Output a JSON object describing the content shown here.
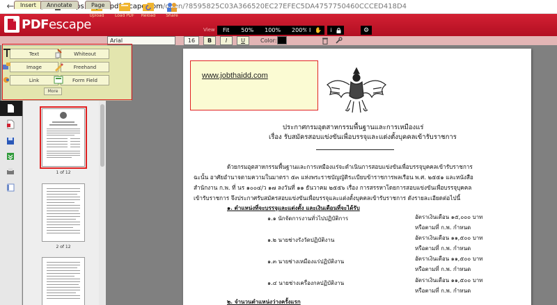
{
  "browser": {
    "url_host": "https://www.pdfescape.com",
    "url_path": "/open/?8595825C03A366520EC27EFEC5DA4757750460CCCED418D4"
  },
  "app": {
    "brand_pdf": "PDF",
    "brand_escape": "escape",
    "toolbar_groups": [
      {
        "label": "Upload"
      },
      {
        "label": "Load PDF"
      },
      {
        "label": "Reload"
      },
      {
        "label": "Share"
      }
    ],
    "view_label": "View",
    "zoom_options": [
      "Fit",
      "50%",
      "100%",
      "200%"
    ],
    "colors": {
      "header": "#c8102e",
      "menu_bg": "#ecefb2",
      "selection": "#e02020"
    }
  },
  "tabs": [
    {
      "label": "Insert",
      "active": true
    },
    {
      "label": "Annotate",
      "active": false
    },
    {
      "label": "Page",
      "active": false
    }
  ],
  "format": {
    "font": "Arial",
    "size": "16",
    "bold": "B",
    "italic": "I",
    "underline": "U",
    "color_label": "Color:",
    "color_value": "#000000"
  },
  "insert_menu": {
    "items": [
      {
        "label": "Text",
        "icon": "text-icon"
      },
      {
        "label": "Whiteout",
        "icon": "whiteout-icon"
      },
      {
        "label": "Image",
        "icon": "image-icon"
      },
      {
        "label": "Freehand",
        "icon": "pencil-icon"
      },
      {
        "label": "Link",
        "icon": "link-icon"
      },
      {
        "label": "Form Field",
        "icon": "form-field-icon"
      }
    ],
    "more_label": "More"
  },
  "thumbnails": [
    {
      "label": "1 of 12",
      "selected": true
    },
    {
      "label": "2 of 12",
      "selected": false
    },
    {
      "label": "",
      "selected": false
    }
  ],
  "document": {
    "textbox": "www.jobthaidd.com",
    "title_line1": "ประกาศกรมอุตสาหกรรมพื้นฐานและการเหมืองแร่",
    "title_line2": "เรื่อง  รับสมัครสอบแข่งขันเพื่อบรรจุและแต่งตั้งบุคคลเข้ารับราชการ",
    "para_lines": [
      "ด้วยกรมอุตสาหกรรมพื้นฐานและการเหมืองแร่จะดำเนินการสอบแข่งขันเพื่อบรรจุบุคคลเข้ารับราชการ",
      "ฉะนั้น อาศัยอำนาจตามความในมาตรา ๕๓ แห่งพระราชบัญญัติระเบียบข้าราชการพลเรือน พ.ศ. ๒๕๕๑ และหนังสือ",
      "สำนักงาน ก.พ. ที่ นร ๑๐๐๔/ว ๑๗ ลงวันที่ ๑๑ ธันวาคม ๒๕๕๖ เรื่อง การสรรหาโดยการสอบแข่งขันเพื่อบรรจุบุคคล",
      "เข้ารับราชการ จึงประกาศรับสมัครสอบแข่งขันเพื่อบรรจุและแต่งตั้งบุคคลเข้ารับราชการ ดังรายละเอียดต่อไปนี้"
    ],
    "section1": "๑.  ตำแหน่งที่จะบรรจุและแต่งตั้ง และเงินเดือนที่จะได้รับ",
    "positions": [
      {
        "name": "๑.๑ นักจัดการงานทั่วไปปฏิบัติการ",
        "salary": "อัตราเงินเดือน ๑๕,๐๐๐ บาท",
        "note": "หรือตามที่ ก.พ. กำหนด"
      },
      {
        "name": "๑.๒ นายช่างรังวัดปฏิบัติงาน",
        "salary": "อัตราเงินเดือน ๑๑,๕๐๐ บาท",
        "note": "หรือตามที่ ก.พ. กำหนด"
      },
      {
        "name": "๑.๓ นายช่างเหมืองแร่ปฏิบัติงาน",
        "salary": "อัตราเงินเดือน ๑๑,๕๐๐ บาท",
        "note": "หรือตามที่ ก.พ. กำหนด"
      },
      {
        "name": "๑.๔ นายช่างเครื่องกลปฏิบัติงาน",
        "salary": "อัตราเงินเดือน ๑๑,๕๐๐ บาท",
        "note": "หรือตามที่ ก.พ. กำหนด"
      }
    ],
    "section2": "๒.  จำนวนตำแหน่งว่างครั้งแรก"
  }
}
